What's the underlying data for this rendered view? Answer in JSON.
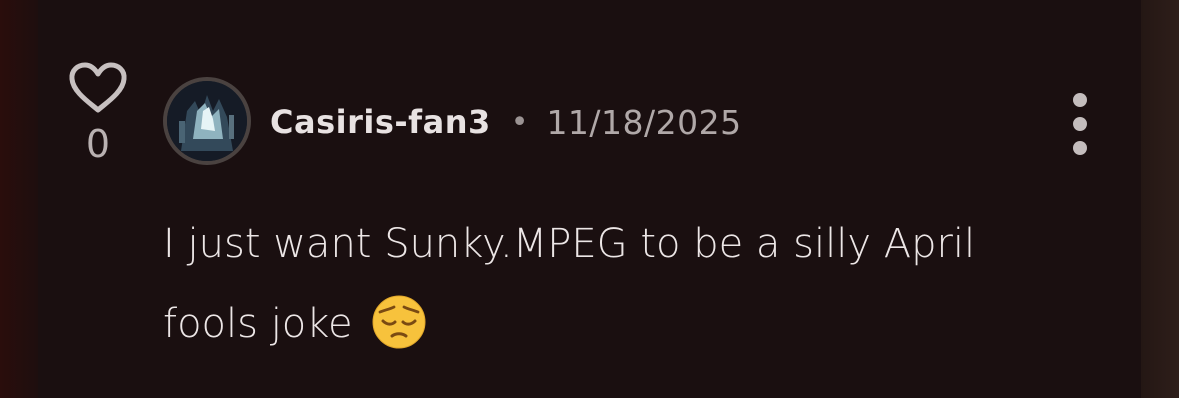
{
  "comment": {
    "likes": "0",
    "username": "Casiris-fan3",
    "separator": "•",
    "date": "11/18/2025",
    "text": "I just want Sunky.MPEG to be a silly April fools joke",
    "emoji": "pensive-face"
  },
  "icons": {
    "like": "heart-outline-icon",
    "more": "vertical-ellipsis-icon"
  },
  "colors": {
    "background": "#1a0f10",
    "text": "#ece6e6",
    "muted": "#b0a8a8"
  }
}
